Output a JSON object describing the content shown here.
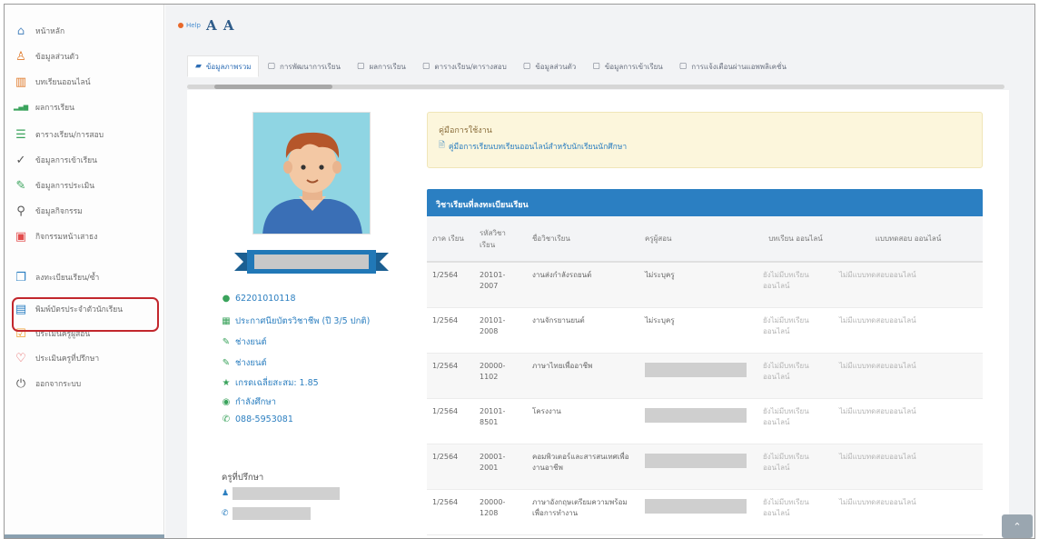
{
  "sidebar": {
    "items": [
      {
        "icon": "home-icon",
        "glyph": "⌂",
        "label": "หน้าหลัก"
      },
      {
        "icon": "user-icon",
        "glyph": "♙",
        "label": "ข้อมูลส่วนตัว"
      },
      {
        "icon": "book-icon",
        "glyph": "▥",
        "label": "บทเรียนออนไลน์"
      },
      {
        "icon": "chart-icon",
        "glyph": "▂▄▆",
        "label": "ผลการเรียน"
      },
      {
        "icon": "list-icon",
        "glyph": "☰",
        "label": "ตารางเรียน/การสอบ"
      },
      {
        "icon": "check-icon",
        "glyph": "✓",
        "label": "ข้อมูลการเข้าเรียน"
      },
      {
        "icon": "pen-icon",
        "glyph": "✎",
        "label": "ข้อมูลการประเมิน"
      },
      {
        "icon": "link-icon",
        "glyph": "⚲",
        "label": "ข้อมูลกิจกรรม"
      },
      {
        "icon": "briefcase-icon",
        "glyph": "▣",
        "label": "กิจกรรมหน้าเสาธง"
      },
      {
        "icon": "folder-icon",
        "glyph": "❐",
        "label": "ลงทะเบียนเรียน/ซ้ำ"
      },
      {
        "icon": "calendar-icon",
        "glyph": "▤",
        "label": "พิมพ์บัตรประจำตัวนักเรียน"
      },
      {
        "icon": "checkbox-icon",
        "glyph": "☑",
        "label": "ประเมินครูผู้สอน"
      },
      {
        "icon": "heart-icon",
        "glyph": "♡",
        "label": "ประเมินครูที่ปรึกษา"
      },
      {
        "icon": "power-icon",
        "glyph": "⏻",
        "label": "ออกจากระบบ"
      }
    ]
  },
  "header": {
    "help_label": "Help",
    "font_size_label": "A A"
  },
  "tabs": [
    {
      "label": "ข้อมูลภาพรวม",
      "active": true
    },
    {
      "label": "การพัฒนาการเรียน",
      "active": false
    },
    {
      "label": "ผลการเรียน",
      "active": false
    },
    {
      "label": "ตารางเรียน/ตารางสอบ",
      "active": false
    },
    {
      "label": "ข้อมูลส่วนตัว",
      "active": false
    },
    {
      "label": "ข้อมูลการเข้าเรียน",
      "active": false
    },
    {
      "label": "การแจ้งเตือนผ่านแอพพลิเคชั่น",
      "active": false
    }
  ],
  "profile": {
    "student_id": "62201010118",
    "program": "ประกาศนียบัตรวิชาชีพ (ปี 3/5 ปกติ)",
    "department": "ช่างยนต์",
    "major": "ช่างยนต์",
    "gpa": "เกรดเฉลี่ยสะสม: 1.85",
    "status": "กำลังศึกษา",
    "phone": "088-5953081",
    "advisor_heading": "ครูที่ปรึกษา"
  },
  "manual": {
    "title": "คู่มือการใช้งาน",
    "link": "คู่มือการเรียนบทเรียนออนไลน์สำหรับนักเรียนนักศึกษา"
  },
  "courses": {
    "title": "วิชาเรียนที่ลงทะเบียนเรียน",
    "headers": [
      "ภาค เรียน",
      "รหัสวิชา เรียน",
      "ชื่อวิชาเรียน",
      "ครูผู้สอน",
      "บทเรียน ออนไลน์",
      "แบบทดสอบ ออนไลน์"
    ],
    "rows": [
      {
        "term": "1/2564",
        "code": "20101-2007",
        "name": "งานส่งกำลังรถยนต์",
        "teacher": "ไม่ระบุครู",
        "lesson": "ยังไม่มีบทเรียนออนไลน์",
        "quiz": "ไม่มีแบบทดสอบออนไลน์",
        "teacher_hidden": false
      },
      {
        "term": "1/2564",
        "code": "20101-2008",
        "name": "งานจักรยานยนต์",
        "teacher": "ไม่ระบุครู",
        "lesson": "ยังไม่มีบทเรียนออนไลน์",
        "quiz": "ไม่มีแบบทดสอบออนไลน์",
        "teacher_hidden": false
      },
      {
        "term": "1/2564",
        "code": "20000-1102",
        "name": "ภาษาไทยเพื่ออาชีพ",
        "teacher": "",
        "lesson": "ยังไม่มีบทเรียนออนไลน์",
        "quiz": "ไม่มีแบบทดสอบออนไลน์",
        "teacher_hidden": true
      },
      {
        "term": "1/2564",
        "code": "20101-8501",
        "name": "โครงงาน",
        "teacher": "",
        "lesson": "ยังไม่มีบทเรียนออนไลน์",
        "quiz": "ไม่มีแบบทดสอบออนไลน์",
        "teacher_hidden": true
      },
      {
        "term": "1/2564",
        "code": "20001-2001",
        "name": "คอมพิวเตอร์และสารสนเทศเพื่องานอาชีพ",
        "teacher": "",
        "lesson": "ยังไม่มีบทเรียนออนไลน์",
        "quiz": "ไม่มีแบบทดสอบออนไลน์",
        "teacher_hidden": true
      },
      {
        "term": "1/2564",
        "code": "20000-1208",
        "name": "ภาษาอังกฤษเตรียมความพร้อมเพื่อการทำงาน",
        "teacher": "",
        "lesson": "ยังไม่มีบทเรียนออนไลน์",
        "quiz": "ไม่มีแบบทดสอบออนไลน์",
        "teacher_hidden": true
      }
    ]
  },
  "colors": {
    "accent": "#2b7fc2",
    "highlight": "#c2272d",
    "manual_bg": "#fcf6dc"
  }
}
